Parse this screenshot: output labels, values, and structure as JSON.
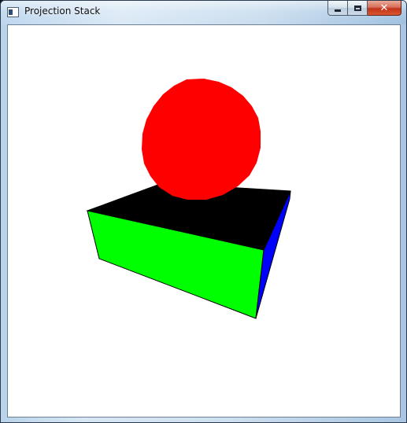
{
  "window": {
    "title": "Projection Stack",
    "icon": "application-icon",
    "buttons": {
      "minimize": "minimize-icon",
      "maximize": "maximize-icon",
      "close": "close-icon"
    }
  },
  "scene": {
    "background": "#ffffff",
    "sphere_color": "#ff0000",
    "box_top_color": "#000000",
    "box_front_color": "#00ff00",
    "box_side_color": "#0000ff",
    "outline_color": "#000000"
  }
}
